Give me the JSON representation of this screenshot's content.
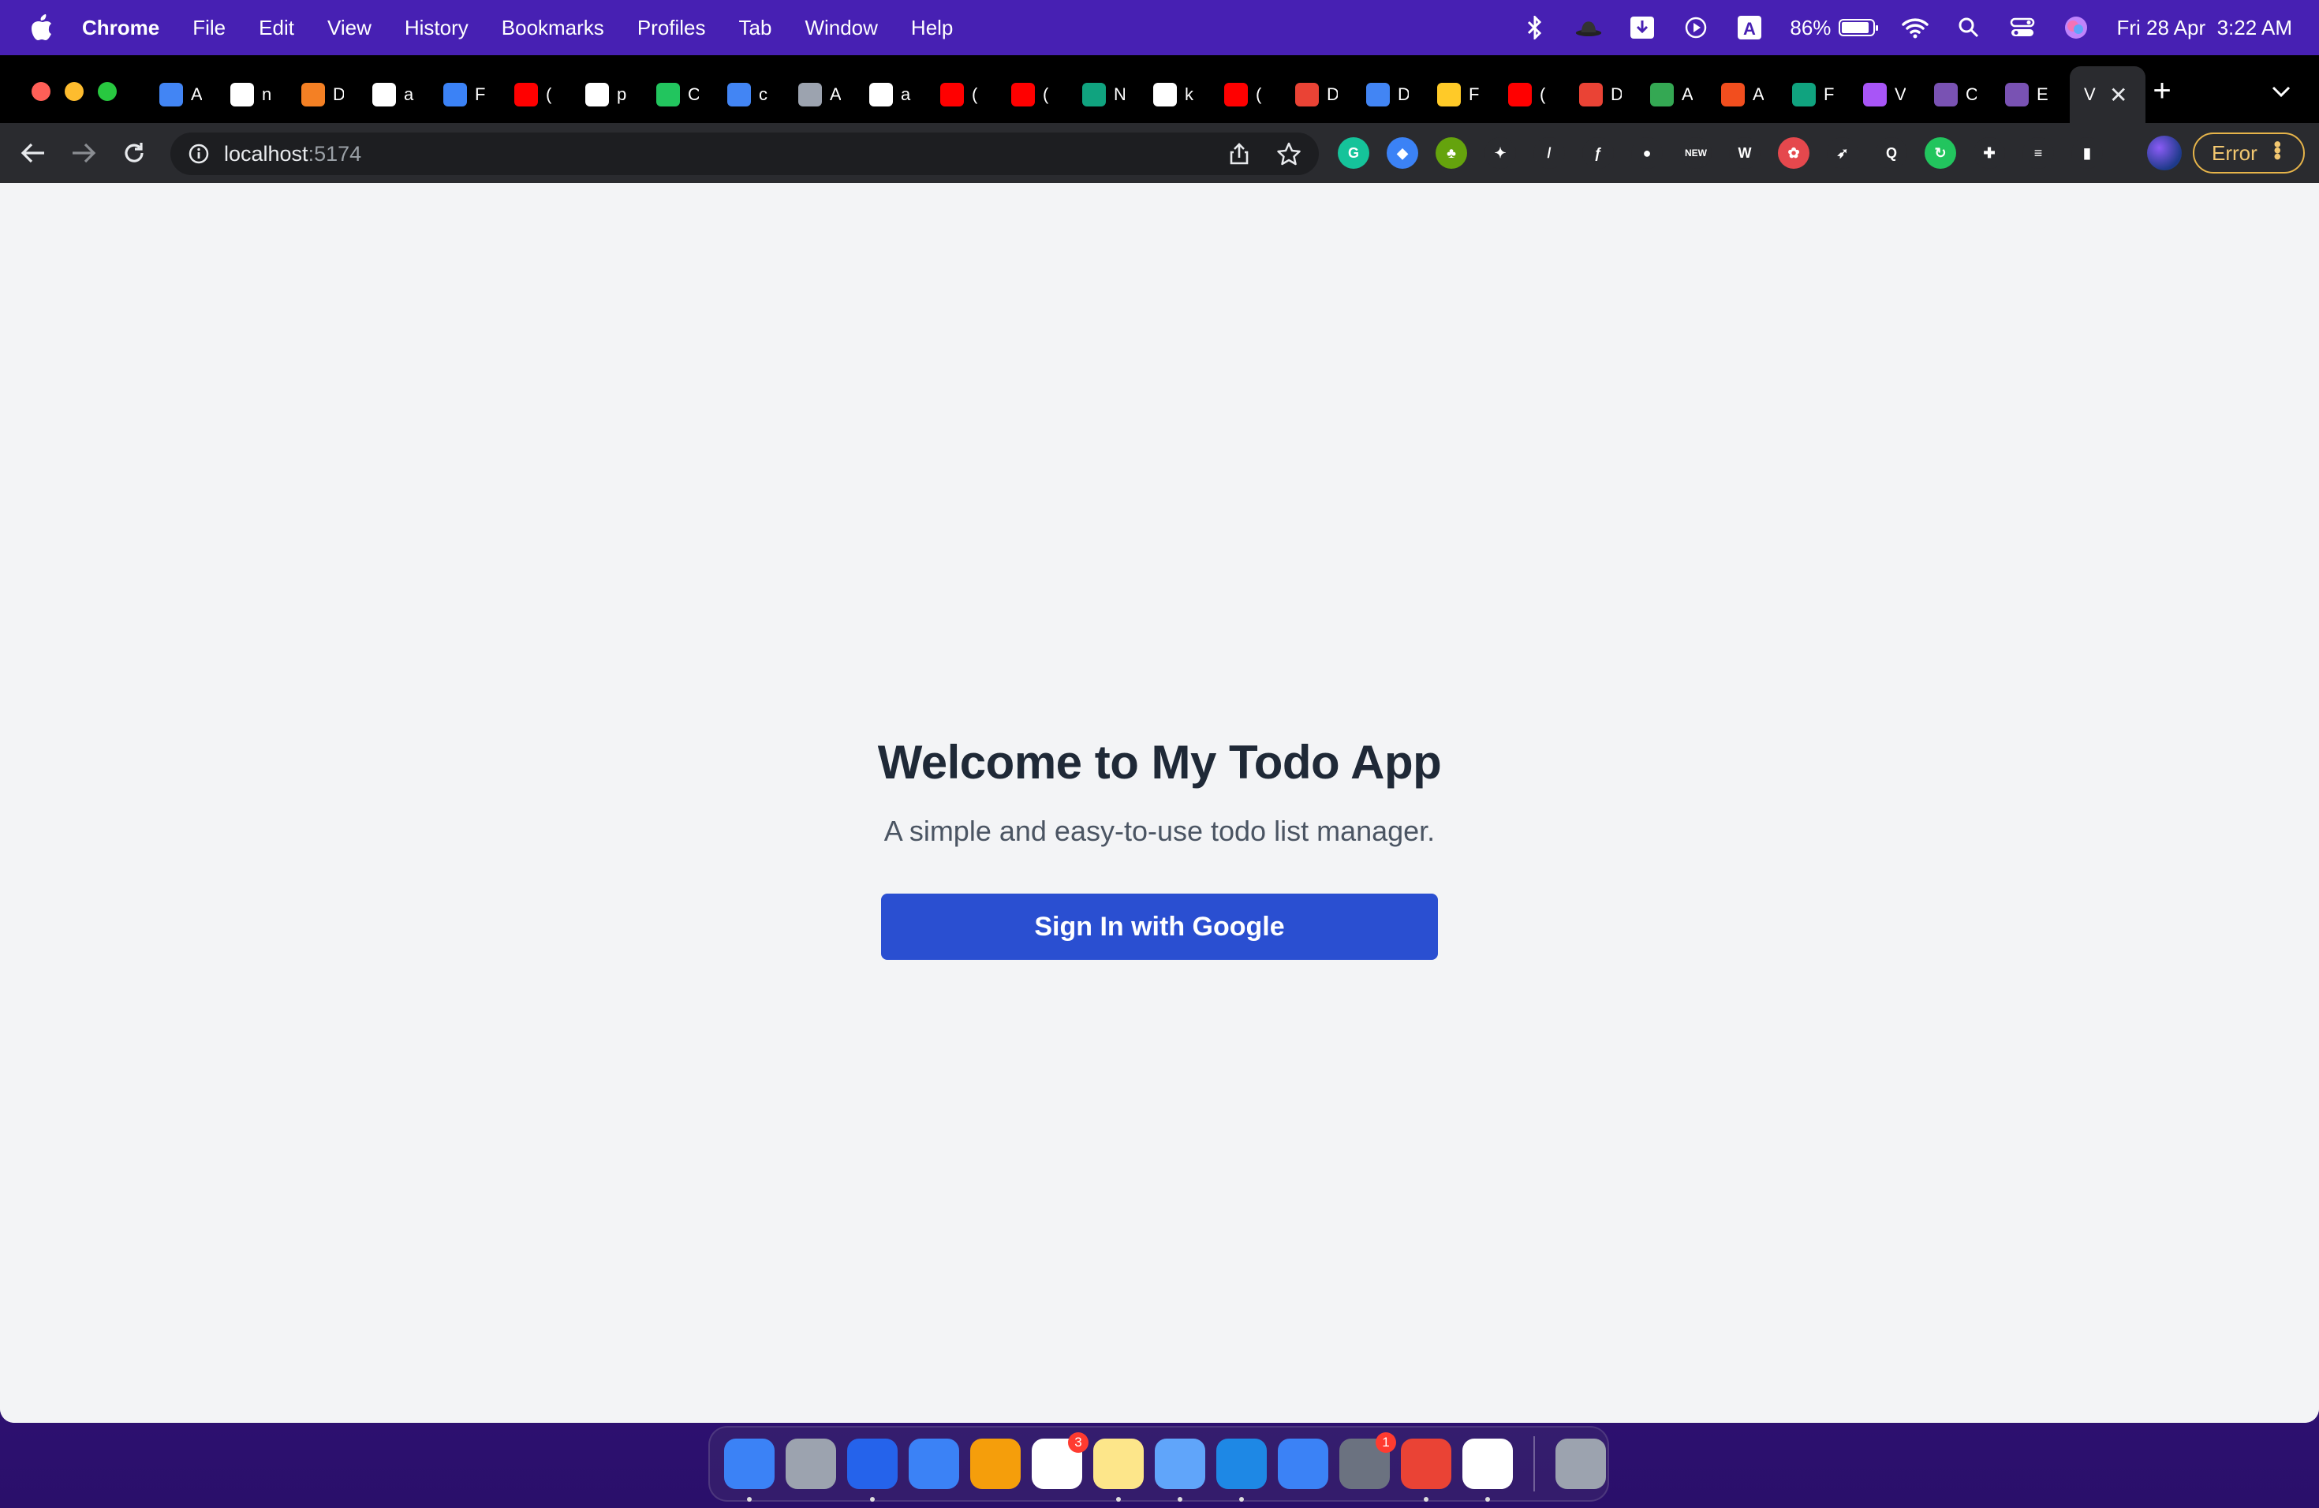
{
  "menubar": {
    "app_name": "Chrome",
    "items": [
      "File",
      "Edit",
      "View",
      "History",
      "Bookmarks",
      "Profiles",
      "Tab",
      "Window",
      "Help"
    ],
    "battery": "86%",
    "datetime": "Fri 28 Apr  3:22 AM"
  },
  "tabs": [
    {
      "text": "A",
      "icon": "google-docs-icon",
      "color": "#4285f4"
    },
    {
      "text": "n",
      "icon": "github-icon",
      "color": "#ffffff"
    },
    {
      "text": "D",
      "icon": "stackoverflow-icon",
      "color": "#f48024"
    },
    {
      "text": "a",
      "icon": "github-icon",
      "color": "#ffffff"
    },
    {
      "text": "F",
      "icon": "reddit-bot-icon",
      "color": "#3b82f6"
    },
    {
      "text": "(",
      "icon": "youtube-icon",
      "color": "#ff0000"
    },
    {
      "text": "p",
      "icon": "github-icon",
      "color": "#ffffff"
    },
    {
      "text": "C",
      "icon": "green-circle-icon",
      "color": "#22c55e"
    },
    {
      "text": "c",
      "icon": "google-docs-icon",
      "color": "#4285f4"
    },
    {
      "text": "A",
      "icon": "globe-icon",
      "color": "#9ca3af"
    },
    {
      "text": "a",
      "icon": "github-icon",
      "color": "#ffffff"
    },
    {
      "text": "(",
      "icon": "youtube-icon",
      "color": "#ff0000"
    },
    {
      "text": "(",
      "icon": "youtube-icon",
      "color": "#ff0000"
    },
    {
      "text": "N",
      "icon": "chatgpt-icon",
      "color": "#10a37f"
    },
    {
      "text": "k",
      "icon": "triangle-icon",
      "color": "#ffffff"
    },
    {
      "text": "(",
      "icon": "youtube-icon",
      "color": "#ff0000"
    },
    {
      "text": "D",
      "icon": "gmail-icon",
      "color": "#ea4335"
    },
    {
      "text": "D",
      "icon": "google-docs-icon",
      "color": "#4285f4"
    },
    {
      "text": "F",
      "icon": "firebase-icon",
      "color": "#ffca28"
    },
    {
      "text": "(",
      "icon": "youtube-icon",
      "color": "#ff0000"
    },
    {
      "text": "D",
      "icon": "gmail-icon",
      "color": "#ea4335"
    },
    {
      "text": "A",
      "icon": "google-drive-icon",
      "color": "#34a853"
    },
    {
      "text": "A",
      "icon": "figma-icon",
      "color": "#f24e1e"
    },
    {
      "text": "F",
      "icon": "chatgpt-icon",
      "color": "#10a37f"
    },
    {
      "text": "V",
      "icon": "vite-icon",
      "color": "#a855f7"
    },
    {
      "text": "C",
      "icon": "bootstrap-icon",
      "color": "#7952b3"
    },
    {
      "text": "E",
      "icon": "bootstrap-icon",
      "color": "#7952b3"
    }
  ],
  "active_tab": {
    "text": "V",
    "close": "✕"
  },
  "new_tab": "+",
  "address": {
    "host": "localhost",
    "port": ":5174"
  },
  "extensions": [
    {
      "name": "grammarly-icon",
      "color": "#15c39a",
      "glyph": "G"
    },
    {
      "name": "gem-extension-icon",
      "color": "#3b82f6",
      "glyph": "◆"
    },
    {
      "name": "tree-extension-icon",
      "color": "#65a30d",
      "glyph": "♣"
    },
    {
      "name": "gnome-extension-icon",
      "color": "#2a2b2f",
      "glyph": "✦"
    },
    {
      "name": "picker-extension-icon",
      "color": "#2a2b2f",
      "glyph": "/"
    },
    {
      "name": "formula-extension-icon",
      "color": "#2a2b2f",
      "glyph": "ƒ"
    },
    {
      "name": "mouse-extension-icon",
      "color": "#2a2b2f",
      "glyph": "●"
    },
    {
      "name": "new-extension-icon",
      "color": "#2a2b2f",
      "glyph": "NEW"
    },
    {
      "name": "wappalyzer-icon",
      "color": "#2a2b2f",
      "glyph": "W"
    },
    {
      "name": "bug-extension-icon",
      "color": "#e5484d",
      "glyph": "✿"
    },
    {
      "name": "rocket-extension-icon",
      "color": "#2a2b2f",
      "glyph": "➶"
    },
    {
      "name": "search-extension-icon",
      "color": "#2a2b2f",
      "glyph": "Q"
    },
    {
      "name": "refresh-extension-icon",
      "color": "#22c55e",
      "glyph": "↻"
    },
    {
      "name": "puzzle-icon",
      "color": "#2a2b2f",
      "glyph": "✚"
    },
    {
      "name": "reading-list-icon",
      "color": "#2a2b2f",
      "glyph": "≡"
    },
    {
      "name": "side-panel-icon",
      "color": "#2a2b2f",
      "glyph": "▮"
    }
  ],
  "error_button": "Error",
  "page": {
    "title": "Welcome to My Todo App",
    "subtitle": "A simple and easy-to-use todo list manager.",
    "signin_label": "Sign In with Google"
  },
  "dock": [
    {
      "name": "finder-icon",
      "color": "#3b82f6",
      "running": true
    },
    {
      "name": "launchpad-icon",
      "color": "#9ca3af",
      "running": false
    },
    {
      "name": "safari-icon",
      "color": "#2563eb",
      "running": true
    },
    {
      "name": "mail-icon",
      "color": "#3b82f6",
      "running": false
    },
    {
      "name": "photos-icon",
      "color": "#f59e0b",
      "running": false
    },
    {
      "name": "reminders-icon",
      "color": "#ffffff",
      "running": false,
      "badge": "3"
    },
    {
      "name": "notes-icon",
      "color": "#fde68a",
      "running": true
    },
    {
      "name": "keynote-icon",
      "color": "#60a5fa",
      "running": true
    },
    {
      "name": "vscode-icon",
      "color": "#1e88e5",
      "running": true
    },
    {
      "name": "app-store-icon",
      "color": "#3b82f6",
      "running": false
    },
    {
      "name": "system-settings-icon",
      "color": "#6b7280",
      "running": false,
      "badge": "1"
    },
    {
      "name": "chrome-icon",
      "color": "#ea4335",
      "running": true
    },
    {
      "name": "mongodb-compass-icon",
      "color": "#ffffff",
      "running": true
    },
    {
      "name": "trash-icon",
      "color": "#9ca3af",
      "running": false
    }
  ]
}
